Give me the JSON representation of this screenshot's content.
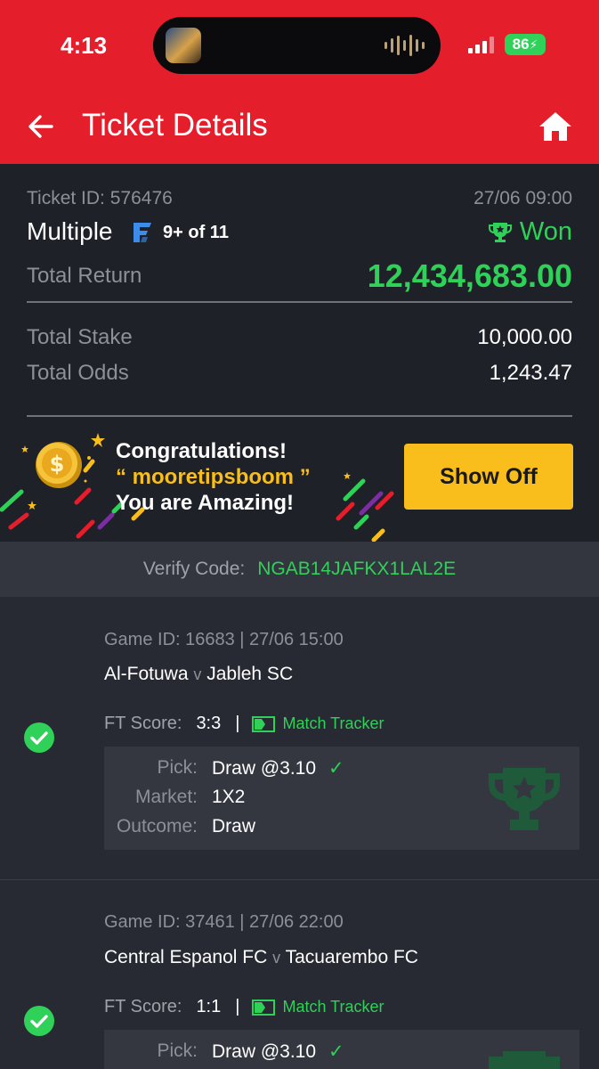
{
  "status_bar": {
    "time": "4:13",
    "battery": "86"
  },
  "app_bar": {
    "title": "Ticket Details"
  },
  "ticket": {
    "id_label": "Ticket ID: 576476",
    "datetime": "27/06 09:00",
    "type": "Multiple",
    "flex_text": "9+ of 11",
    "status": "Won",
    "total_return_label": "Total Return",
    "total_return": "12,434,683.00",
    "total_stake_label": "Total Stake",
    "total_stake": "10,000.00",
    "total_odds_label": "Total Odds",
    "total_odds": "1,243.47"
  },
  "banner": {
    "line1": "Congratulations!",
    "quote_open": "“",
    "username": "mooretipsboom",
    "quote_close": "”",
    "line3": "You are Amazing!",
    "button": "Show Off"
  },
  "verify": {
    "label": "Verify Code:",
    "code": "NGAB14JAFKX1LAL2E"
  },
  "games": [
    {
      "id_line": "Game ID: 16683 | 27/06 15:00",
      "home": "Al-Fotuwa",
      "vs": "v",
      "away": "Jableh SC",
      "ft_label": "FT Score:",
      "score": "3:3",
      "separator": "|",
      "tracker": "Match Tracker",
      "pick_label": "Pick:",
      "pick": "Draw @3.10",
      "market_label": "Market:",
      "market": "1X2",
      "outcome_label": "Outcome:",
      "outcome": "Draw"
    },
    {
      "id_line": "Game ID: 37461 | 27/06 22:00",
      "home": "Central Espanol FC",
      "vs": "v",
      "away": "Tacuarembo FC",
      "ft_label": "FT Score:",
      "score": "1:1",
      "separator": "|",
      "tracker": "Match Tracker",
      "pick_label": "Pick:",
      "pick": "Draw @3.10"
    }
  ],
  "colors": {
    "brand_red": "#e41e2b",
    "win_green": "#2fd158",
    "accent_yellow": "#f9bd1c"
  },
  "icons": [
    "back-arrow-icon",
    "home-icon",
    "flex-icon",
    "trophy-icon",
    "coin-icon",
    "check-circle-icon",
    "tracker-icon",
    "checkmark-icon"
  ]
}
